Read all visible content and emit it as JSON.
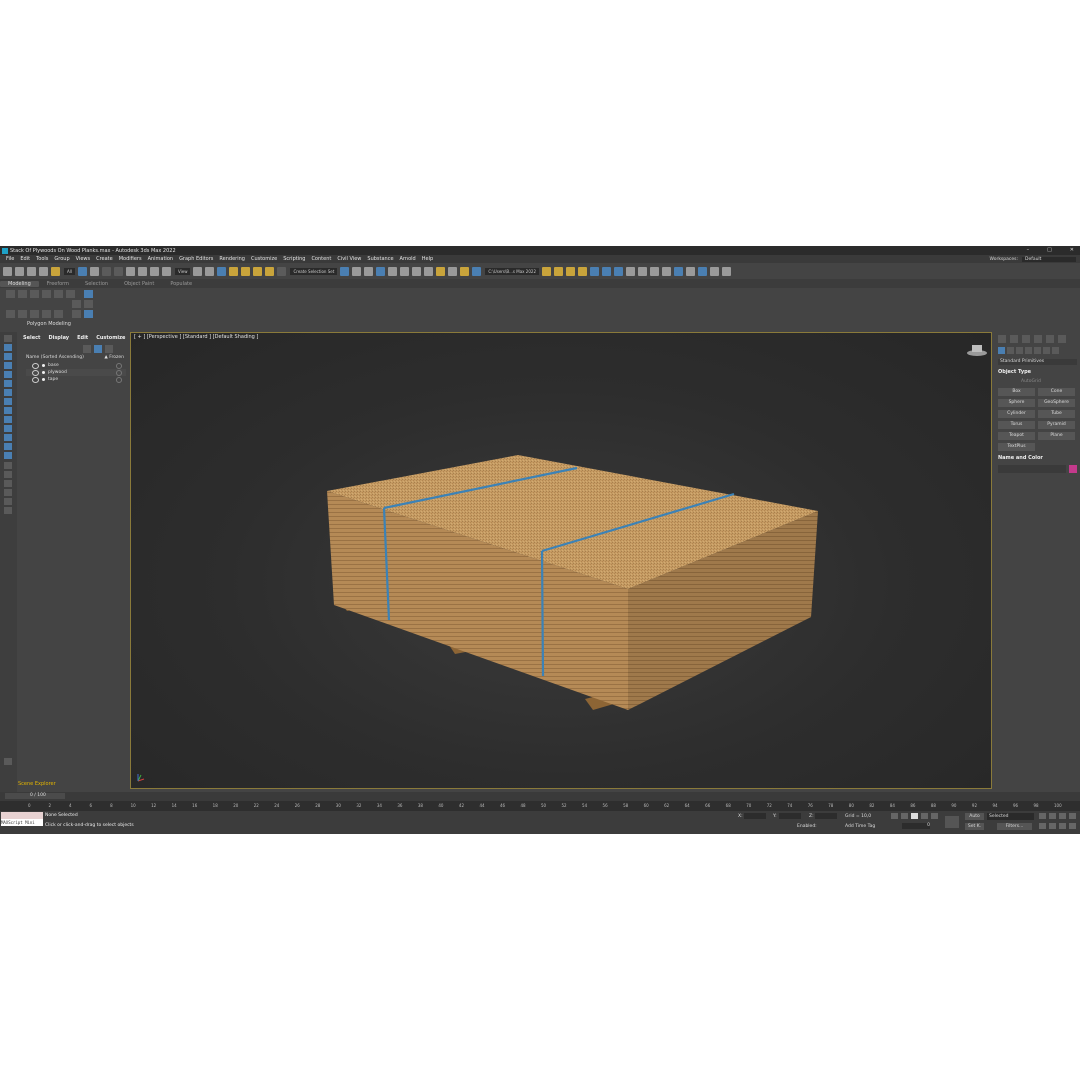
{
  "window": {
    "title": "Stack Of Plywoods On Wood Planks.max - Autodesk 3ds Max 2022",
    "controls": [
      "–",
      "□",
      "✕"
    ]
  },
  "menu": [
    "File",
    "Edit",
    "Tools",
    "Group",
    "Views",
    "Create",
    "Modifiers",
    "Animation",
    "Graph Editors",
    "Rendering",
    "Customize",
    "Scripting",
    "Content",
    "Civil View",
    "Substance",
    "Arnold",
    "Help"
  ],
  "workspace": {
    "label": "Workspaces:",
    "value": "Default"
  },
  "toolbar": {
    "filter": "All",
    "view": "View",
    "selection_set": "Create Selection Set",
    "path": "C:\\Users\\B...s Max 2022"
  },
  "ribbon": {
    "tabs": [
      "Modeling",
      "Freeform",
      "Selection",
      "Object Paint",
      "Populate"
    ],
    "group_label": "Polygon Modeling"
  },
  "explorer": {
    "tabs": [
      "Select",
      "Display",
      "Edit",
      "Customize"
    ],
    "column": "Name (Sorted Ascending)",
    "frozen_col": "▲ Frozen",
    "items": [
      {
        "name": "base"
      },
      {
        "name": "plywood"
      },
      {
        "name": "tape"
      }
    ],
    "label": "Scene Explorer"
  },
  "viewport": {
    "label": "[ + ] [Perspective ] [Standard ] [Default Shading ]",
    "board_color": "#c49a62",
    "strap_color": "#3c82b6"
  },
  "command_panel": {
    "category": "Standard Primitives",
    "object_type_title": "Object Type",
    "autogrid": "AutoGrid",
    "buttons": [
      "Box",
      "Cone",
      "Sphere",
      "GeoSphere",
      "Cylinder",
      "Tube",
      "Torus",
      "Pyramid",
      "Teapot",
      "Plane",
      "TextPlus"
    ],
    "name_color_title": "Name and Color",
    "color": "#c43a8c"
  },
  "timeline": {
    "frame": "0 / 100",
    "ticks": [
      "0",
      "2",
      "4",
      "6",
      "8",
      "10",
      "12",
      "14",
      "16",
      "18",
      "20",
      "22",
      "24",
      "26",
      "28",
      "30",
      "32",
      "34",
      "36",
      "38",
      "40",
      "42",
      "44",
      "46",
      "48",
      "50",
      "52",
      "54",
      "56",
      "58",
      "60",
      "62",
      "64",
      "66",
      "68",
      "70",
      "72",
      "74",
      "76",
      "78",
      "80",
      "82",
      "84",
      "86",
      "88",
      "90",
      "92",
      "94",
      "96",
      "98",
      "100"
    ]
  },
  "status": {
    "maxscript": "MAXScript Mini",
    "selected": "None Selected",
    "hint": "Click or click-and-drag to select objects",
    "x_label": "X:",
    "y_label": "Y:",
    "z_label": "Z:",
    "grid": "Grid = 10,0",
    "enabled": "Enabled:",
    "add_time_tag": "Add Time Tag",
    "auto": "Auto",
    "set_k": "Set K.",
    "selected_dd": "Selected",
    "filters": "Filters...",
    "frame_value": "0"
  }
}
